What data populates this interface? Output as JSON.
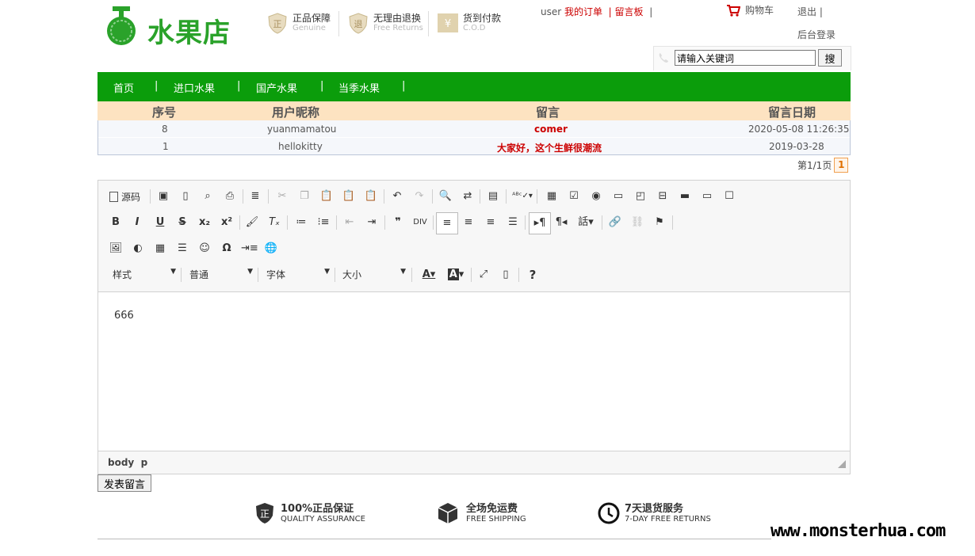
{
  "header": {
    "logo_text": "水果店",
    "promos": [
      {
        "title": "正品保障",
        "sub": "Genuine"
      },
      {
        "title": "无理由退换",
        "sub": "Free Returns"
      },
      {
        "title": "货到付款",
        "sub": "C.O.D"
      }
    ],
    "user_label": "user",
    "my_orders": "我的订单",
    "message_board": "留言板",
    "sep": "|",
    "cart": "购物车",
    "logout": "退出",
    "admin_login": "后台登录",
    "search_placeholder": "请输入关键词",
    "search_button": "搜"
  },
  "nav": {
    "items": [
      "首页",
      "进口水果",
      "国产水果",
      "当季水果"
    ],
    "sep": "|"
  },
  "table": {
    "headers": [
      "序号",
      "用户昵称",
      "留言",
      "留言日期"
    ],
    "rows": [
      {
        "id": "8",
        "user": "yuanmamatou",
        "message": "comer",
        "date": "2020-05-08 11:26:35"
      },
      {
        "id": "1",
        "user": "hellokitty",
        "message": "大家好，这个生鲜很潮流",
        "date": "2019-03-28"
      }
    ],
    "pager_text": "第1/1页",
    "current_page": "1"
  },
  "editor": {
    "source_label": "源码",
    "combos": [
      "样式",
      "普通",
      "字体",
      "大小"
    ],
    "content": "666",
    "path": "body  p",
    "help": "?"
  },
  "submit_label": "发表留言",
  "footer": {
    "items": [
      {
        "title": "100%正品保证",
        "sub": "QUALITY ASSURANCE",
        "icon_char": "正"
      },
      {
        "title": "全场免运费",
        "sub": "FREE SHIPPING"
      },
      {
        "title": "7天退货服务",
        "sub": "7-DAY FREE RETURNS"
      }
    ]
  },
  "watermark": "www.monsterhua.com",
  "colors": {
    "nav_green": "#0b9d0b",
    "logo_green": "#2aa22a",
    "link_red": "#cc0000",
    "table_head": "#fde3c1"
  }
}
